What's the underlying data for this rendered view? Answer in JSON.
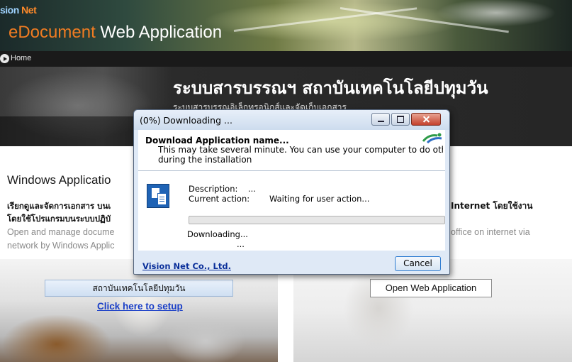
{
  "banner": {
    "brand_prefix": "sion",
    "brand_suffix": "Net",
    "title_accent": "eDocument",
    "title_rest": "Web Application"
  },
  "nav": {
    "home_label": "Home"
  },
  "hero": {
    "title": "ระบบสารบรรณฯ สถาบันเทคโนโลยีปทุมวัน",
    "subtitle": "ระบบสารบรรณอิเล็กทรอนิกส์และจัดเก็บเอกสาร"
  },
  "left_section": {
    "heading": "Windows Applicatio",
    "desc_thai_line1": "เรียกดูและจัดการเอกสาร บนเ",
    "desc_thai_line2": "โดยใช้โปรแกรมบนระบบปฏิบั",
    "desc_en_line1": "Open and manage docume",
    "desc_en_line2": "network by Windows Applic",
    "setup_bar_label": "สถาบันเทคโนโลยีปทุมวัน",
    "setup_link": "Click here to setup"
  },
  "right_section": {
    "desc_thai": "Internet โดยใช้งาน",
    "desc_en": "office on internet via",
    "open_button": "Open Web Application"
  },
  "dialog": {
    "title": "(0%) Downloading ...",
    "heading": "Download Application name...",
    "message_line1": "This may take several minute. You can use your computer to do other tas",
    "message_line2": "during the installation",
    "description_label": "Description:",
    "description_value": "...",
    "action_label": "Current action:",
    "action_value": "Waiting for user action...",
    "progress_percent": 0,
    "status_text": "Downloading...",
    "status_dots": "...",
    "company_link": "Vision Net Co., Ltd.",
    "cancel_label": "Cancel"
  },
  "colors": {
    "accent_orange": "#f07c22",
    "link_blue": "#1a3fc7",
    "progress_green": "#37b449"
  },
  "icons": [
    "home-arrow-icon",
    "minimize-icon",
    "maximize-icon",
    "close-icon",
    "installer-icon",
    "vision-net-logo-icon"
  ]
}
